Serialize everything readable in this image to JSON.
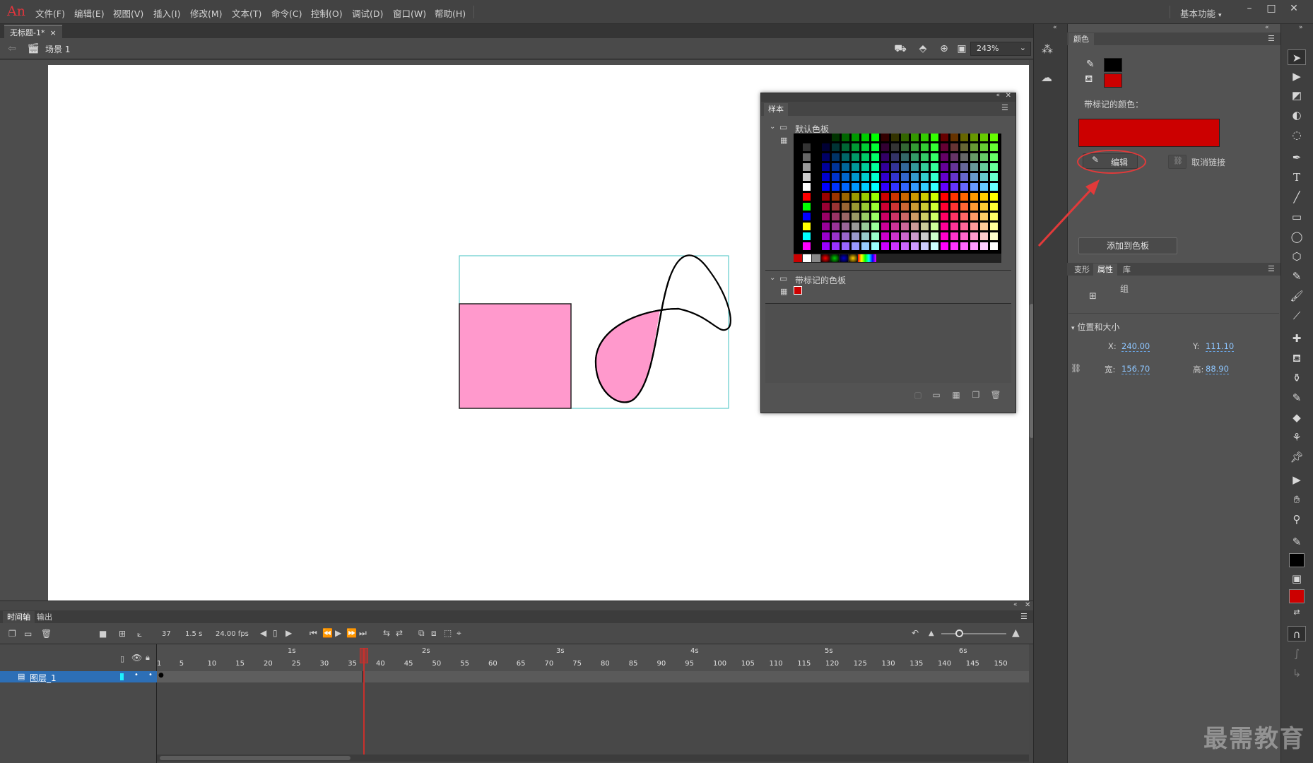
{
  "app": {
    "logo": "An",
    "menu": [
      "文件(F)",
      "编辑(E)",
      "视图(V)",
      "插入(I)",
      "修改(M)",
      "文本(T)",
      "命令(C)",
      "控制(O)",
      "调试(D)",
      "窗口(W)",
      "帮助(H)"
    ],
    "workspace": "基本功能"
  },
  "document": {
    "tab_title": "无标题-1*",
    "tab_close": "×",
    "scene": "场景 1",
    "zoom": "243%"
  },
  "swatches_panel": {
    "tab": "样本",
    "default_palette": "默认色板",
    "marked_palette": "带标记的色板"
  },
  "color_panel": {
    "tab": "颜色",
    "stroke_color": "#000000",
    "fill_color": "#cc0000",
    "marked_color_label": "带标记的颜色：",
    "marked_color": "#cc0000",
    "edit_label": "编辑",
    "unlink_label": "取消链接",
    "add_to_swatches": "添加到色板"
  },
  "properties_panel": {
    "tabs": [
      "变形",
      "属性",
      "库"
    ],
    "group_type": "组",
    "section": "位置和大小",
    "x_label": "X:",
    "x_value": "240.00",
    "y_label": "Y:",
    "y_value": "111.10",
    "w_label": "宽:",
    "w_value": "156.70",
    "h_label": "高:",
    "h_value": "88.90"
  },
  "timeline": {
    "tabs": [
      "时间轴",
      "输出"
    ],
    "current_frame": "37",
    "elapsed": "1.5 s",
    "fps": "24.00 fps",
    "seconds": [
      "1s",
      "2s",
      "3s",
      "4s",
      "5s",
      "6s"
    ],
    "frame_numbers": [
      "1",
      "5",
      "10",
      "15",
      "20",
      "25",
      "30",
      "35",
      "40",
      "45",
      "50",
      "55",
      "60",
      "65",
      "70",
      "75",
      "80",
      "85",
      "90",
      "95",
      "100",
      "105",
      "110",
      "115",
      "120",
      "125",
      "130",
      "135",
      "140",
      "145",
      "150"
    ],
    "layer_name": "图层_1"
  },
  "stage": {
    "rect_fill": "#ff99cc",
    "bbox_color": "#40c0c0"
  },
  "watermark": "最需教育"
}
